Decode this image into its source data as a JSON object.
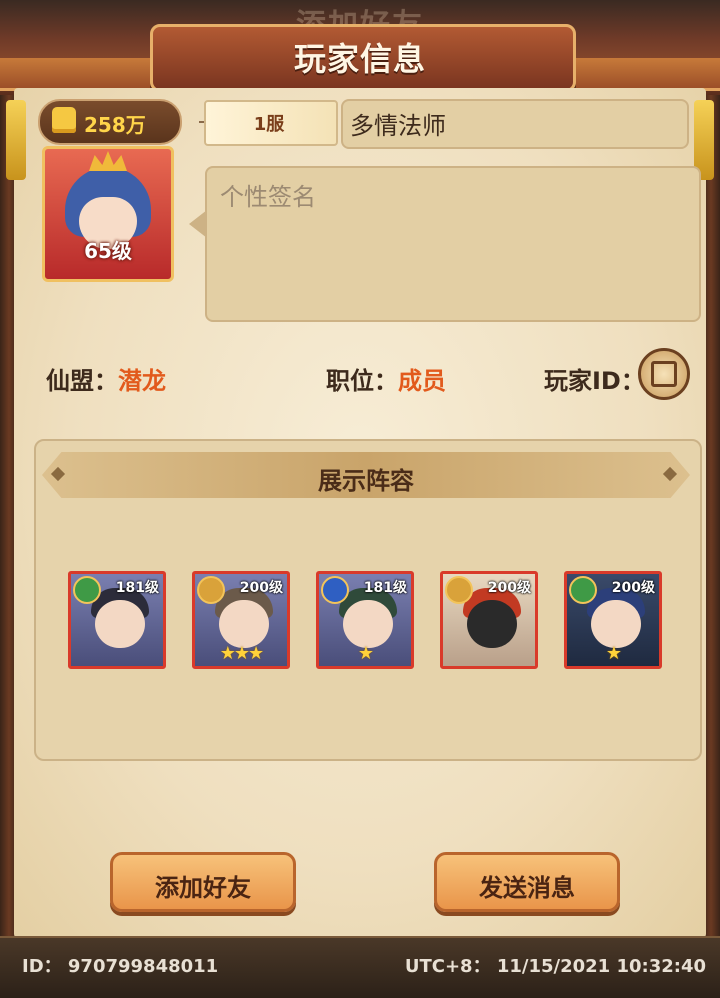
{
  "header": {
    "ghost_title": "添加好友",
    "title": "玩家信息"
  },
  "profile": {
    "power": "258万",
    "server": "1服",
    "name": "多情法师",
    "level": "65级",
    "signature_placeholder": "个性签名"
  },
  "info": {
    "guild_label": "仙盟：",
    "guild_value": "潜龙",
    "position_label": "职位：",
    "position_value": "成员",
    "player_id_label": "玩家ID："
  },
  "lineup": {
    "title": "展示阵容",
    "heroes": [
      {
        "level": "181级",
        "stars": "",
        "element": "wood-icon",
        "element_color": "#3f9a46"
      },
      {
        "level": "200级",
        "stars": "★★★",
        "element": "gold-icon",
        "element_color": "#d9a23a"
      },
      {
        "level": "181级",
        "stars": "★",
        "element": "water-icon",
        "element_color": "#2f5fc2"
      },
      {
        "level": "200级",
        "stars": "",
        "element": "gold-icon",
        "element_color": "#d9a23a"
      },
      {
        "level": "200级",
        "stars": "★",
        "element": "wood-icon",
        "element_color": "#3f9a46"
      }
    ]
  },
  "actions": {
    "add_friend": "添加好友",
    "send_message": "发送消息"
  },
  "footer": {
    "id": "ID：  970799848011",
    "timestamp": "UTC+8：  11/15/2021 10:32:40"
  },
  "colors": {
    "accent_orange": "#e25a1c",
    "power_gold": "#ffd54a",
    "button_fill": "#f2ab60"
  }
}
